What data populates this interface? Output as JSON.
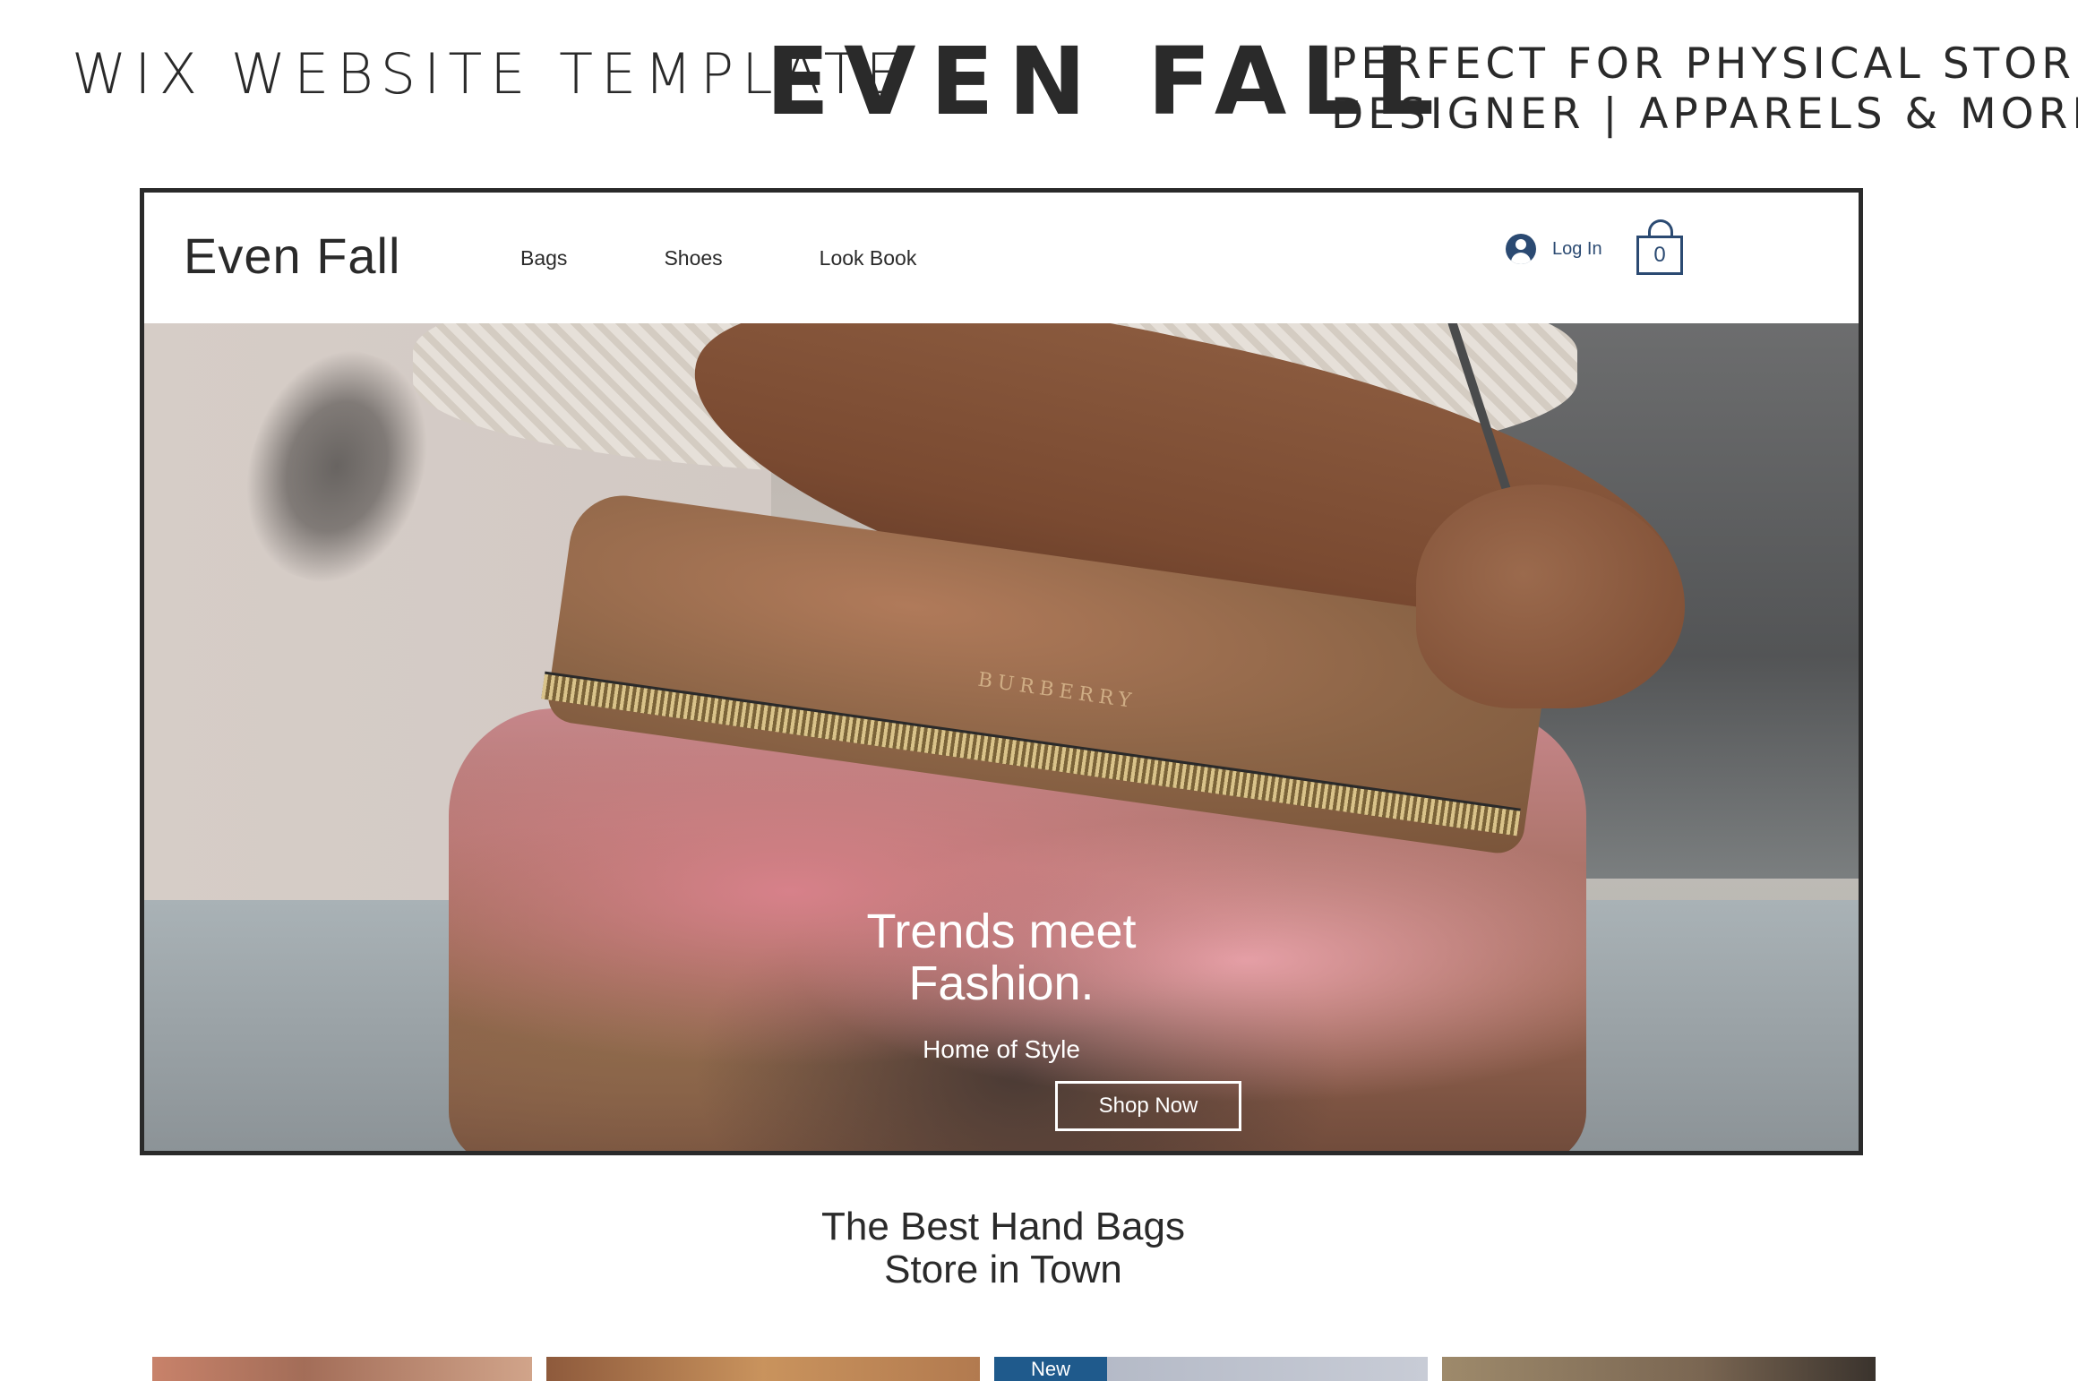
{
  "banner": {
    "left": "WIX WEBSITE TEMPLATE",
    "center": "EVEN FALL",
    "right_line1": "PERFECT FOR PHYSICAL STORES|",
    "right_line2": "DESIGNER | APPARELS & MORE"
  },
  "site": {
    "logo": "Even Fall",
    "nav": [
      "Bags",
      "Shoes",
      "Look Book"
    ],
    "login_label": "Log In",
    "cart_count": "0",
    "accent_color": "#2b4a72"
  },
  "hero": {
    "headline_line1": "Trends meet",
    "headline_line2": "Fashion.",
    "subhead": "Home of Style",
    "cta_label": "Shop Now",
    "brand_mark": "BURBERRY"
  },
  "section": {
    "title_line1": "The Best Hand Bags",
    "title_line2": "Store in Town"
  },
  "products": {
    "badge": "New",
    "badge_color": "#1f5a8c"
  }
}
